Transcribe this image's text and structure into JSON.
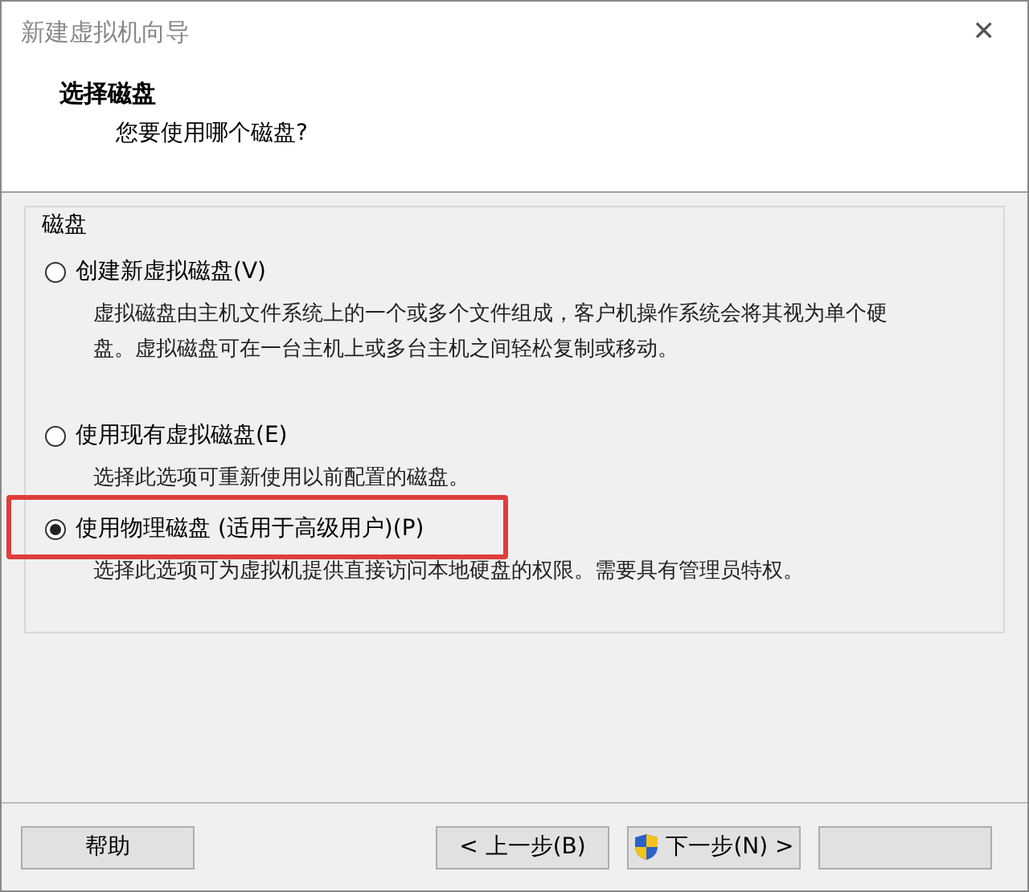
{
  "window": {
    "title": "新建虚拟机向导",
    "close": "✕"
  },
  "header": {
    "title": "选择磁盘",
    "subtitle": "您要使用哪个磁盘?"
  },
  "group": {
    "label": "磁盘",
    "options": [
      {
        "label": "创建新虚拟磁盘(V)",
        "description": "虚拟磁盘由主机文件系统上的一个或多个文件组成，客户机操作系统会将其视为单个硬盘。虚拟磁盘可在一台主机上或多台主机之间轻松复制或移动。",
        "selected": false,
        "highlighted": false
      },
      {
        "label": "使用现有虚拟磁盘(E)",
        "description": "选择此选项可重新使用以前配置的磁盘。",
        "selected": false,
        "highlighted": false
      },
      {
        "label": "使用物理磁盘 (适用于高级用户)(P)",
        "description": "选择此选项可为虚拟机提供直接访问本地硬盘的权限。需要具有管理员特权。",
        "selected": true,
        "highlighted": true
      }
    ]
  },
  "buttons": [
    {
      "label": "帮助",
      "kind": "help"
    },
    {
      "label": "< 上一步(B)",
      "kind": "nav"
    },
    {
      "label": "下一步(N) >",
      "kind": "shield"
    },
    {
      "kind": "blank"
    }
  ]
}
